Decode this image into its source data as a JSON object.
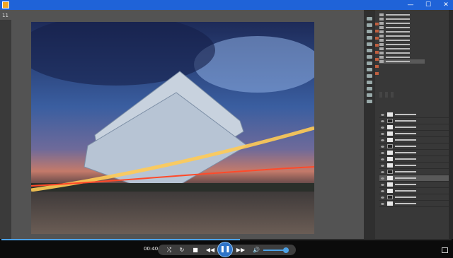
{
  "player": {
    "tab_number": "11",
    "time": "00:40",
    "progress": 0.53,
    "volume": 0.9
  },
  "icons": [
    "app-icon",
    "minimize-icon",
    "maximize-icon",
    "close-icon",
    "shuffle-icon",
    "repeat-icon",
    "stop-icon",
    "previous-icon",
    "pause-icon",
    "next-icon",
    "volume-icon",
    "fullscreen-icon"
  ]
}
